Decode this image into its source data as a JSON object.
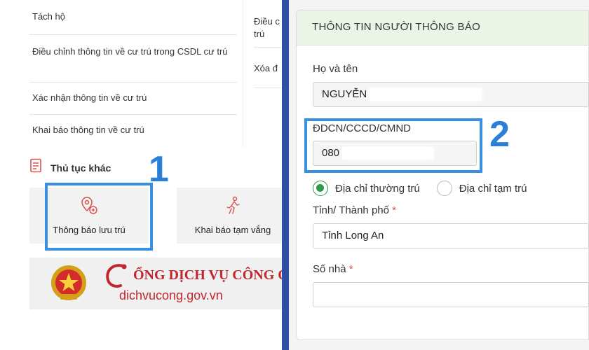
{
  "left_menu": {
    "items": [
      "Tách hộ",
      "Điều chỉnh thông tin về cư trú trong CSDL cư trú",
      "Xác nhận thông tin về cư trú",
      "Khai báo thông tin về cư trú"
    ],
    "right_items": [
      "Điều c\ntrú",
      "Xóa đ"
    ]
  },
  "other_procedures": {
    "title": "Thủ tục khác",
    "tiles": [
      {
        "label": "Thông báo lưu trú",
        "icon": "location-pin-icon"
      },
      {
        "label": "Khai báo tạm vắng",
        "icon": "person-walking-icon"
      }
    ]
  },
  "banner": {
    "title": "CỔNG DỊCH VỤ CÔNG QU",
    "title_visible": "ỔNG DỊCH VỤ CÔNG Q",
    "url": "dichvucong.gov.vn"
  },
  "annotations": {
    "step1": "1",
    "step2": "2",
    "color": "#2b7fd9"
  },
  "form": {
    "header": "THÔNG TIN NGƯỜI THÔNG BÁO",
    "name_label": "Họ và tên",
    "name_value": "NGUYỄN",
    "id_label": "ĐDCN/CCCD/CMND",
    "id_value": "080",
    "radio_permanent": "Địa chỉ thường trú",
    "radio_temporary": "Địa chỉ tạm trú",
    "province_label": "Tỉnh/ Thành phố",
    "province_value": "Tỉnh Long An",
    "house_label": "Số nhà",
    "required_mark": "*"
  },
  "colors": {
    "accent": "#3b8fe0",
    "header_bg": "#eaf4e7",
    "radio_on": "#2f9a4a",
    "brand_red": "#c2272d",
    "frame": "#2f4fa3"
  }
}
